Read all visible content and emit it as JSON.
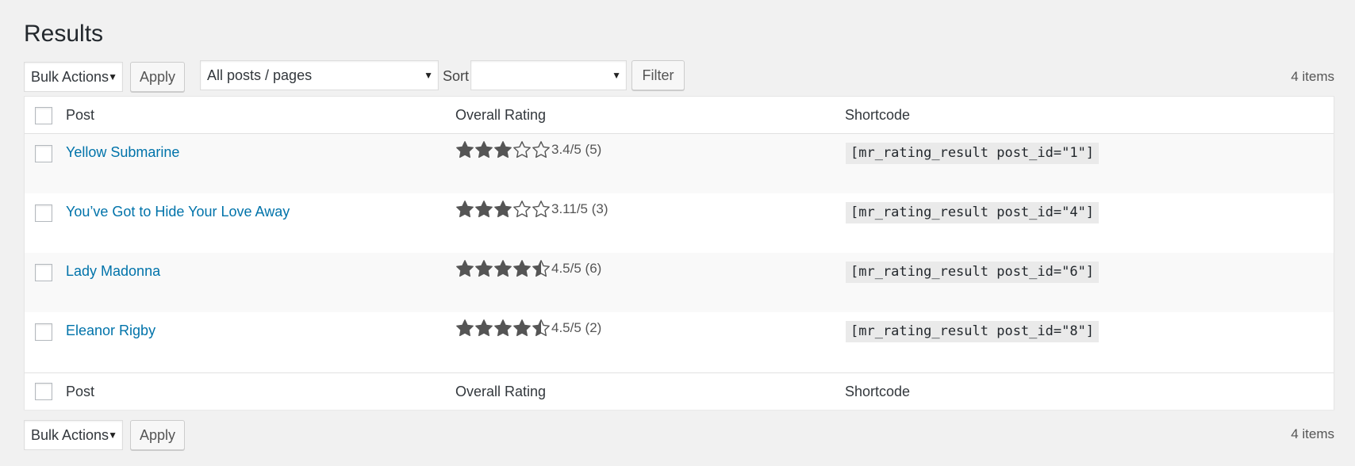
{
  "page_title": "Results",
  "top_nav": {
    "bulk_actions": "Bulk Actions",
    "apply_label": "Apply",
    "posts_filter": "All posts / pages",
    "sort_label": "Sort",
    "sort_value": "",
    "filter_label": "Filter",
    "item_count": "4 items"
  },
  "bottom_nav": {
    "bulk_actions": "Bulk Actions",
    "apply_label": "Apply",
    "item_count": "4 items"
  },
  "table": {
    "columns": {
      "post": "Post",
      "rating": "Overall Rating",
      "shortcode": "Shortcode"
    },
    "rows": [
      {
        "title": "Yellow Submarine",
        "rating": 3.4,
        "rating_text": "3.4/5 (5)",
        "shortcode": "[mr_rating_result post_id=\"1\"]"
      },
      {
        "title": "You’ve Got to Hide Your Love Away",
        "rating": 3.11,
        "rating_text": "3.11/5 (3)",
        "shortcode": "[mr_rating_result post_id=\"4\"]"
      },
      {
        "title": "Lady Madonna",
        "rating": 4.5,
        "rating_text": "4.5/5 (6)",
        "shortcode": "[mr_rating_result post_id=\"6\"]"
      },
      {
        "title": "Eleanor Rigby",
        "rating": 4.5,
        "rating_text": "4.5/5 (2)",
        "shortcode": "[mr_rating_result post_id=\"8\"]"
      }
    ]
  },
  "colors": {
    "link": "#0073aa",
    "star": "#555555",
    "background": "#f1f1f1"
  },
  "icons": {
    "star_full": "star-filled-icon",
    "star_half": "star-half-icon",
    "star_empty": "star-empty-icon",
    "dropdown": "chevron-down-icon"
  }
}
